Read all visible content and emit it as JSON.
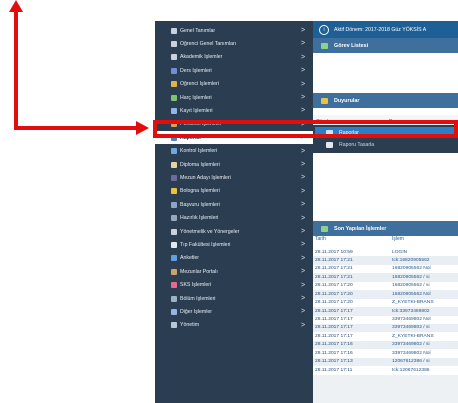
{
  "sidebar": {
    "items": [
      {
        "label": "Genel Tanımlar",
        "icon": "wrench-icon",
        "color": "#c9d2dc"
      },
      {
        "label": "Öğrenci Genel Tanımları",
        "icon": "wrench-icon",
        "color": "#c9d2dc"
      },
      {
        "label": "Akademik İşlemler",
        "icon": "wrench-icon",
        "color": "#c9d2dc"
      },
      {
        "label": "Ders İşlemleri",
        "icon": "books-icon",
        "color": "#6e8fd8"
      },
      {
        "label": "Öğrenci İşlemleri",
        "icon": "student-icon",
        "color": "#e0b24a"
      },
      {
        "label": "Harç İşlemleri",
        "icon": "money-icon",
        "color": "#7fc46a"
      },
      {
        "label": "Kayıt İşlemleri",
        "icon": "register-icon",
        "color": "#8fb6e6"
      },
      {
        "label": "Personel İşlemleri",
        "icon": "staff-icon",
        "color": "#d7a15a"
      },
      {
        "label": "Raporlar",
        "icon": "report-icon",
        "color": "#4f86c6",
        "active": true
      },
      {
        "label": "Kontrol İşlemleri",
        "icon": "check-icon",
        "color": "#6fa8dc"
      },
      {
        "label": "Diploma İşlemleri",
        "icon": "diploma-icon",
        "color": "#e6d49a"
      },
      {
        "label": "Mezun Adayı İşlemleri",
        "icon": "graduate-icon",
        "color": "#6b6b9e"
      },
      {
        "label": "Bologna İşlemleri",
        "icon": "star-icon",
        "color": "#e8c23a"
      },
      {
        "label": "Başvuru İşlemleri",
        "icon": "application-icon",
        "color": "#8fa3c4"
      },
      {
        "label": "Hazırlık İşlemleri",
        "icon": "prep-icon",
        "color": "#9aa7b8"
      },
      {
        "label": "Yönetmelik ve Yönergeler",
        "icon": "regulation-icon",
        "color": "#c9d2dc"
      },
      {
        "label": "Tıp Fakültesi İşlemleri",
        "icon": "medical-icon",
        "color": "#e3e8ee"
      },
      {
        "label": "Anketler",
        "icon": "survey-icon",
        "color": "#5fa0e0"
      },
      {
        "label": "Mezunlar Portalı",
        "icon": "alumni-icon",
        "color": "#c9a36b"
      },
      {
        "label": "SKS İşlemleri",
        "icon": "heart-icon",
        "color": "#e46a8a"
      },
      {
        "label": "Bölüm İşlemleri",
        "icon": "department-icon",
        "color": "#9fb1c4"
      },
      {
        "label": "Diğer İşlemler",
        "icon": "folder-icon",
        "color": "#8fb6e6"
      },
      {
        "label": "Yönetim",
        "icon": "shield-icon",
        "color": "#b9c6d4"
      }
    ],
    "chevron": ">"
  },
  "topbar": {
    "text": "Aktif Dönem: 2017-2018 Güz YÖKSİS A"
  },
  "gorev": {
    "title": "Görev Listesi"
  },
  "duyurular": {
    "title": "Duyurular",
    "col_sender": "Gönderen",
    "col_announcement": "Duyuru"
  },
  "reports": {
    "items": [
      {
        "label": "Raporlar"
      },
      {
        "label": "Raporu Tasarla"
      }
    ]
  },
  "recent": {
    "title": "Son Yapılan İşlemler",
    "col_date": "Tarih",
    "col_op": "İşlem",
    "rows": [
      {
        "date": "28.11.2017 10:59",
        "op": "LOGIN"
      },
      {
        "date": "28.11.2017 17:21",
        "op": "tck:16820905562"
      },
      {
        "date": "28.11.2017 17:21",
        "op": "16820905562 Nol"
      },
      {
        "date": "28.11.2017 17:21",
        "op": "16820905562 / si"
      },
      {
        "date": "28.11.2017 17:20",
        "op": "16820905562 / si"
      },
      {
        "date": "28.11.2017 17:20",
        "op": "16820905562 Nol"
      },
      {
        "date": "28.11.2017 17:20",
        "op": "Z_KYETKI-BRANS"
      },
      {
        "date": "28.11.2017 17:17",
        "op": "tck:33973469802"
      },
      {
        "date": "28.11.2017 17:17",
        "op": "33973469802 Nol"
      },
      {
        "date": "28.11.2017 17:17",
        "op": "33973469802 / si"
      },
      {
        "date": "28.11.2017 17:17",
        "op": "Z_KYETKI-BRANS"
      },
      {
        "date": "28.11.2017 17:16",
        "op": "33973469802 / si"
      },
      {
        "date": "28.11.2017 17:16",
        "op": "33973469802 Nol"
      },
      {
        "date": "28.11.2017 17:13",
        "op": "12067612386 / si"
      },
      {
        "date": "28.11.2017 17:11",
        "op": "tck:12067612386"
      }
    ]
  },
  "colors": {
    "annotation": "#e10e0e",
    "sidebar": "#2b3e51",
    "header": "#1e5f95",
    "active_item": "#2d7ec6"
  }
}
